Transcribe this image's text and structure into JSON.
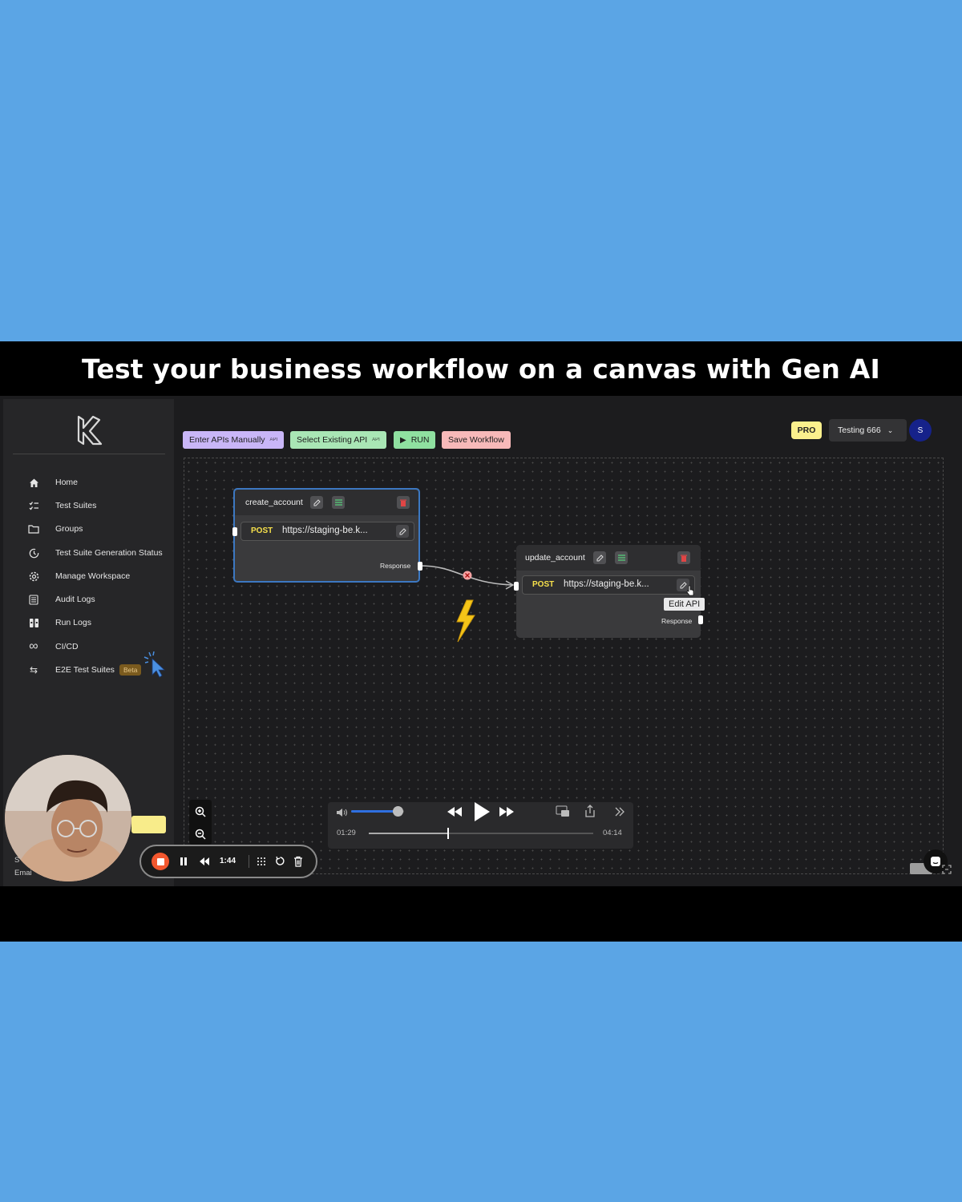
{
  "banner": {
    "title": "Test your business workflow on a canvas with Gen AI"
  },
  "sidebar": {
    "items": [
      {
        "label": "Home",
        "icon": "home-icon"
      },
      {
        "label": "Test Suites",
        "icon": "checklist-icon"
      },
      {
        "label": "Groups",
        "icon": "folder-icon"
      },
      {
        "label": "Test Suite Generation Status",
        "icon": "status-clock-icon"
      },
      {
        "label": "Manage Workspace",
        "icon": "gear-icon"
      },
      {
        "label": "Audit Logs",
        "icon": "audit-list-icon"
      },
      {
        "label": "Run Logs",
        "icon": "run-logs-icon"
      },
      {
        "label": "CI/CD",
        "icon": "infinity-icon"
      },
      {
        "label": "E2E Test Suites",
        "icon": "swap-arrows-icon",
        "badge": "Beta"
      }
    ],
    "footer_partial": {
      "line1": "S",
      "line2": "Emai"
    }
  },
  "toolbar": {
    "enter_apis_label": "Enter APIs Manually",
    "select_api_label": "Select Existing API",
    "run_label": "RUN",
    "save_label": "Save Workflow",
    "colors": {
      "enter": "#c9b6f7",
      "select": "#a9e6b5",
      "run": "#8fe0a0",
      "save": "#f7b9b9"
    }
  },
  "header": {
    "plan_badge": "PRO",
    "workspace": "Testing 666",
    "avatar_initial": "S"
  },
  "canvas": {
    "nodes": [
      {
        "title": "create_account",
        "method": "POST",
        "url": "https://staging-be.k...",
        "output_label": "Response",
        "selected": true
      },
      {
        "title": "update_account",
        "method": "POST",
        "url": "https://staging-be.k...",
        "output_label": "Response",
        "selected": false
      }
    ],
    "tooltip": "Edit API"
  },
  "player": {
    "current_time": "01:29",
    "total_time": "04:14",
    "progress": 0.35,
    "volume": 0.88
  },
  "recorder": {
    "elapsed": "1:44"
  }
}
